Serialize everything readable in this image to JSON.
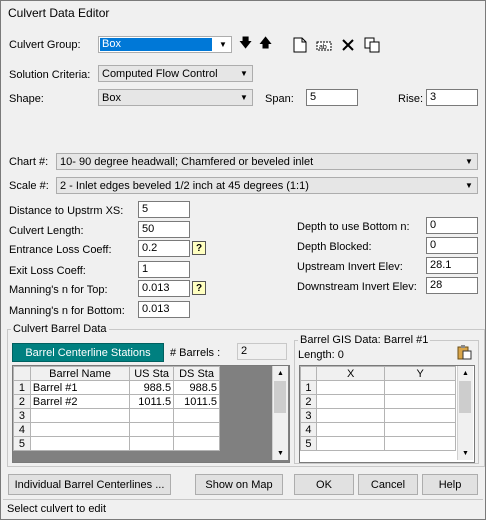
{
  "window": {
    "title": "Culvert Data Editor"
  },
  "culvert_group": {
    "label": "Culvert Group:",
    "value": "Box"
  },
  "solution_criteria": {
    "label": "Solution Criteria:",
    "value": "Computed Flow Control"
  },
  "shape": {
    "label": "Shape:",
    "value": "Box",
    "span_label": "Span:",
    "span_value": "5",
    "rise_label": "Rise:",
    "rise_value": "3"
  },
  "chart": {
    "label": "Chart #:",
    "value": "10- 90 degree headwall; Chamfered or beveled inlet"
  },
  "scale": {
    "label": "Scale #:",
    "value": "2 - Inlet edges beveled 1/2 inch at 45 degrees (1:1)"
  },
  "fields": {
    "distance_label": "Distance to Upstrm XS:",
    "distance_value": "5",
    "length_label": "Culvert Length:",
    "length_value": "50",
    "entrance_label": "Entrance Loss Coeff:",
    "entrance_value": "0.2",
    "exit_label": "Exit Loss Coeff:",
    "exit_value": "1",
    "manning_top_label": "Manning's n for Top:",
    "manning_top_value": "0.013",
    "manning_bottom_label": "Manning's n for Bottom:",
    "manning_bottom_value": "0.013",
    "depth_bottom_label": "Depth to use Bottom n:",
    "depth_bottom_value": "0",
    "depth_blocked_label": "Depth Blocked:",
    "depth_blocked_value": "0",
    "us_invert_label": "Upstream Invert Elev:",
    "us_invert_value": "28.1",
    "ds_invert_label": "Downstream Invert Elev:",
    "ds_invert_value": "28"
  },
  "barrel_data": {
    "group_label": "Culvert Barrel Data",
    "stations_button": "Barrel Centerline Stations",
    "barrels_label": "# Barrels :",
    "barrels_value": "2",
    "columns": [
      "Barrel Name",
      "US Sta",
      "DS Sta"
    ],
    "rows": [
      {
        "n": "1",
        "name": "Barrel #1",
        "us": "988.5",
        "ds": "988.5"
      },
      {
        "n": "2",
        "name": "Barrel #2",
        "us": "1011.5",
        "ds": "1011.5"
      },
      {
        "n": "3",
        "name": "",
        "us": "",
        "ds": ""
      },
      {
        "n": "4",
        "name": "",
        "us": "",
        "ds": ""
      },
      {
        "n": "5",
        "name": "",
        "us": "",
        "ds": ""
      }
    ]
  },
  "gis_data": {
    "group_label": "Barrel GIS Data: Barrel #1",
    "length_label": "Length: 0",
    "columns": [
      "X",
      "Y"
    ],
    "rows": [
      "1",
      "2",
      "3",
      "4",
      "5"
    ]
  },
  "buttons": {
    "individual": "Individual Barrel Centerlines ...",
    "show_map": "Show on Map",
    "ok": "OK",
    "cancel": "Cancel",
    "help": "Help"
  },
  "status": "Select culvert to edit"
}
